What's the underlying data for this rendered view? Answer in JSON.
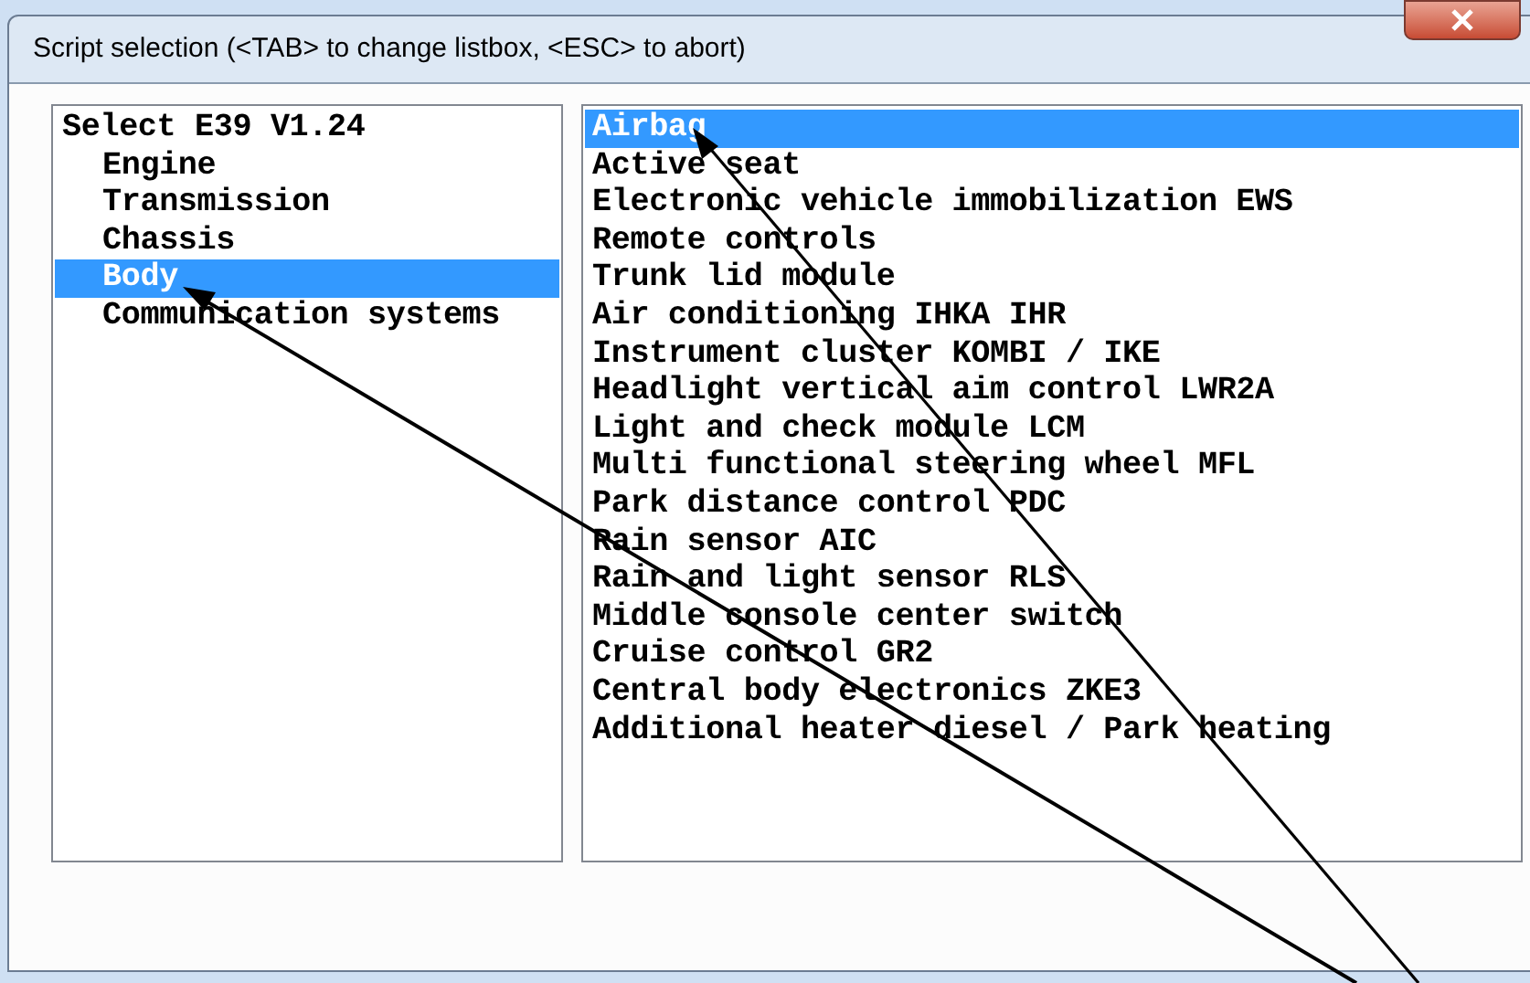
{
  "window": {
    "title": "Script selection   (<TAB> to change listbox, <ESC> to abort)"
  },
  "categories": {
    "items": [
      {
        "label": "Select E39 V1.24",
        "selected": false,
        "children": [
          {
            "label": "Engine",
            "selected": false
          },
          {
            "label": "Transmission",
            "selected": false
          },
          {
            "label": "Chassis",
            "selected": false
          },
          {
            "label": "Body",
            "selected": true
          },
          {
            "label": "Communication systems",
            "selected": false
          }
        ]
      }
    ]
  },
  "scripts": {
    "items": [
      {
        "label": "Airbag",
        "selected": true
      },
      {
        "label": "Active seat",
        "selected": false
      },
      {
        "label": "Electronic vehicle immobilization EWS",
        "selected": false
      },
      {
        "label": "Remote controls",
        "selected": false
      },
      {
        "label": "Trunk lid module",
        "selected": false
      },
      {
        "label": "Air conditioning IHKA IHR",
        "selected": false
      },
      {
        "label": "Instrument cluster KOMBI / IKE",
        "selected": false
      },
      {
        "label": "Headlight vertical aim control LWR2A",
        "selected": false
      },
      {
        "label": "Light and check module LCM",
        "selected": false
      },
      {
        "label": "Multi functional steering wheel MFL",
        "selected": false
      },
      {
        "label": "Park distance control PDC",
        "selected": false
      },
      {
        "label": "Rain sensor AIC",
        "selected": false
      },
      {
        "label": "Rain and light sensor RLS",
        "selected": false
      },
      {
        "label": "Middle console center switch",
        "selected": false
      },
      {
        "label": "Cruise control GR2",
        "selected": false
      },
      {
        "label": "Central body electronics ZKE3",
        "selected": false
      },
      {
        "label": "Additional heater diesel / Park heating",
        "selected": false
      }
    ]
  }
}
